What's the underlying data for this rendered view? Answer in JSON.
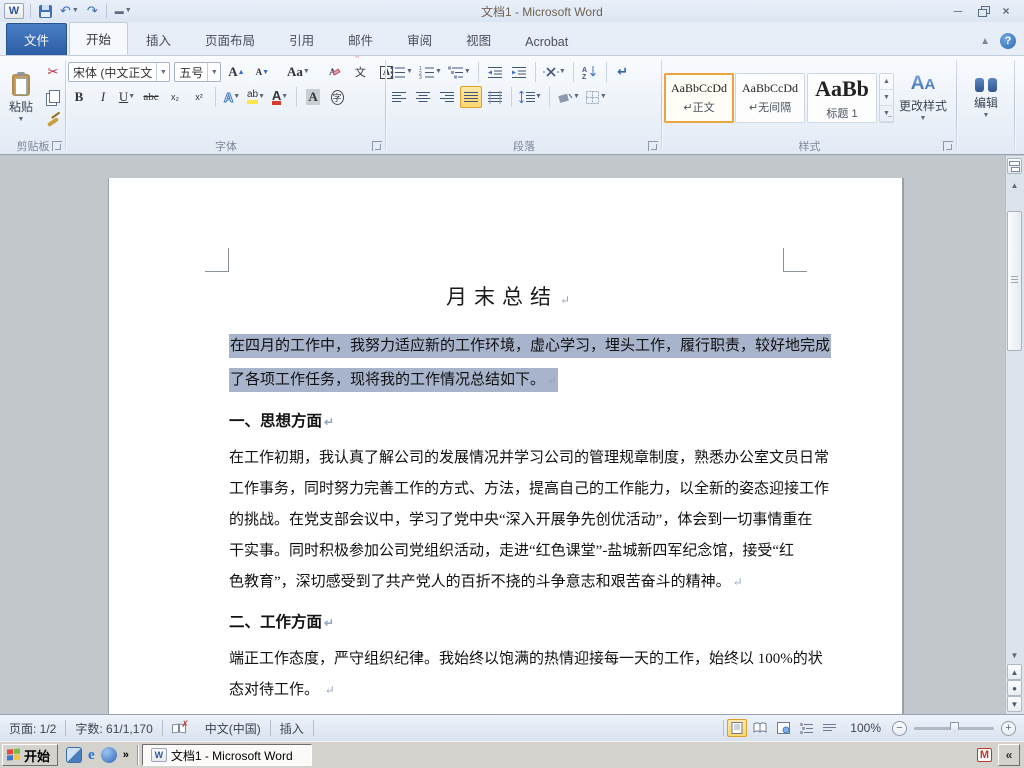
{
  "window": {
    "title": "文档1 - Microsoft Word"
  },
  "tabs": {
    "file": "文件",
    "home": "开始",
    "insert": "插入",
    "layout": "页面布局",
    "references": "引用",
    "mailings": "邮件",
    "review": "审阅",
    "view": "视图",
    "acrobat": "Acrobat"
  },
  "ribbon": {
    "clipboard": {
      "label": "剪贴板",
      "paste": "粘贴"
    },
    "font": {
      "label": "字体",
      "name": "宋体 (中文正文",
      "size": "五号",
      "glyphs": {
        "grow": "A",
        "shrink": "A",
        "case": "Aa",
        "clear": "A",
        "phonetic": "文",
        "charborder": "A",
        "bold": "B",
        "italic": "I",
        "underline": "U",
        "strike": "abc",
        "subscript": "x₂",
        "superscript": "x²",
        "effects": "A",
        "highlight": "ab",
        "color": "A",
        "charshade": "A",
        "enclose": "字"
      }
    },
    "paragraph": {
      "label": "段落"
    },
    "styles": {
      "label": "样式",
      "change": "更改样式",
      "change_icon": "A",
      "cards": [
        {
          "preview": "AaBbCcDd",
          "name": "↵正文"
        },
        {
          "preview": "AaBbCcDd",
          "name": "↵无间隔"
        },
        {
          "preview": "AaBb",
          "name": "标题 1"
        }
      ]
    },
    "editing": {
      "label": "编辑"
    }
  },
  "document": {
    "title": "月末总结",
    "selected": {
      "line1": "在四月的工作中，我努力适应新的工作环境，虚心学习，埋头工作，履行职责，较好地完成",
      "line2": "了各项工作任务，现将我的工作情况总结如下。"
    },
    "section1": {
      "heading": "一、思想方面",
      "lines": [
        "在工作初期，我认真了解公司的发展情况并学习公司的管理规章制度，熟悉办公室文员日常",
        "工作事务，同时努力完善工作的方式、方法，提高自己的工作能力，以全新的姿态迎接工作",
        "的挑战。在党支部会议中，学习了党中央“深入开展争先创优活动”，体会到一切事情重在",
        "干实事。同时积极参加公司党组织活动，走进“红色课堂”-盐城新四军纪念馆，接受“红"
      ],
      "last": "色教育”，深切感受到了共产党人的百折不挠的斗争意志和艰苦奋斗的精神。"
    },
    "section2": {
      "heading": "二、工作方面",
      "lines": [
        "端正工作态度，严守组织纪律。我始终以饱满的热情迎接每一天的工作，始终以 100%的状"
      ],
      "last": "态对待工作。 "
    }
  },
  "status": {
    "page": "页面: 1/2",
    "words": "字数: 61/1,170",
    "lang": "中文(中国)",
    "mode": "插入",
    "zoom": "100%"
  },
  "taskbar": {
    "start": "开始",
    "task": "文档1 - Microsoft Word",
    "tray_m": "M"
  }
}
